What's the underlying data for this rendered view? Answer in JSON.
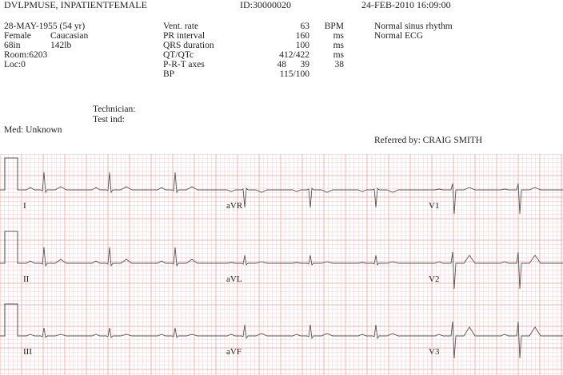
{
  "header": {
    "name": "DVLPMUSE, INPATIENTFEMALE",
    "id": "ID:30000020",
    "datetime": "24-FEB-2010 16:09:00"
  },
  "patient": {
    "dob_age": "28-MAY-1955 (54 yr)",
    "sex": "Female",
    "race": "Caucasian",
    "height": "68in",
    "weight": "142lb",
    "room": "Room:6203",
    "loc": "Loc:0"
  },
  "measurements": {
    "vent_rate": {
      "label": "Vent. rate",
      "value": "63",
      "unit": "BPM"
    },
    "pr_interval": {
      "label": "PR interval",
      "value": "160",
      "unit": "ms"
    },
    "qrs_duration": {
      "label": "QRS duration",
      "value": "100",
      "unit": "ms"
    },
    "qt_qtc": {
      "label": "QT/QTc",
      "value": "412/422",
      "unit": "ms"
    },
    "prt_axes": {
      "label": "P-R-T axes",
      "p": "48",
      "r": "39",
      "t": "38"
    },
    "bp": {
      "label": "BP",
      "value": "115/100"
    }
  },
  "interpretation": {
    "line1": "Normal sinus rhythm",
    "line2": "Normal ECG"
  },
  "technician_label": "Technician:",
  "test_ind_label": "Test ind:",
  "med_label": "Med: Unknown",
  "referred_by": "Referred by:  CRAIG SMITH",
  "ecg": {
    "grid_color": "#f4c0c0",
    "grid_major_color": "#eaa3a3",
    "trace_color": "#555555",
    "rows": [
      {
        "leads": [
          "I",
          "aVR",
          "V1"
        ]
      },
      {
        "leads": [
          "II",
          "aVL",
          "V2"
        ]
      },
      {
        "leads": [
          "III",
          "aVF",
          "V3"
        ]
      }
    ]
  }
}
